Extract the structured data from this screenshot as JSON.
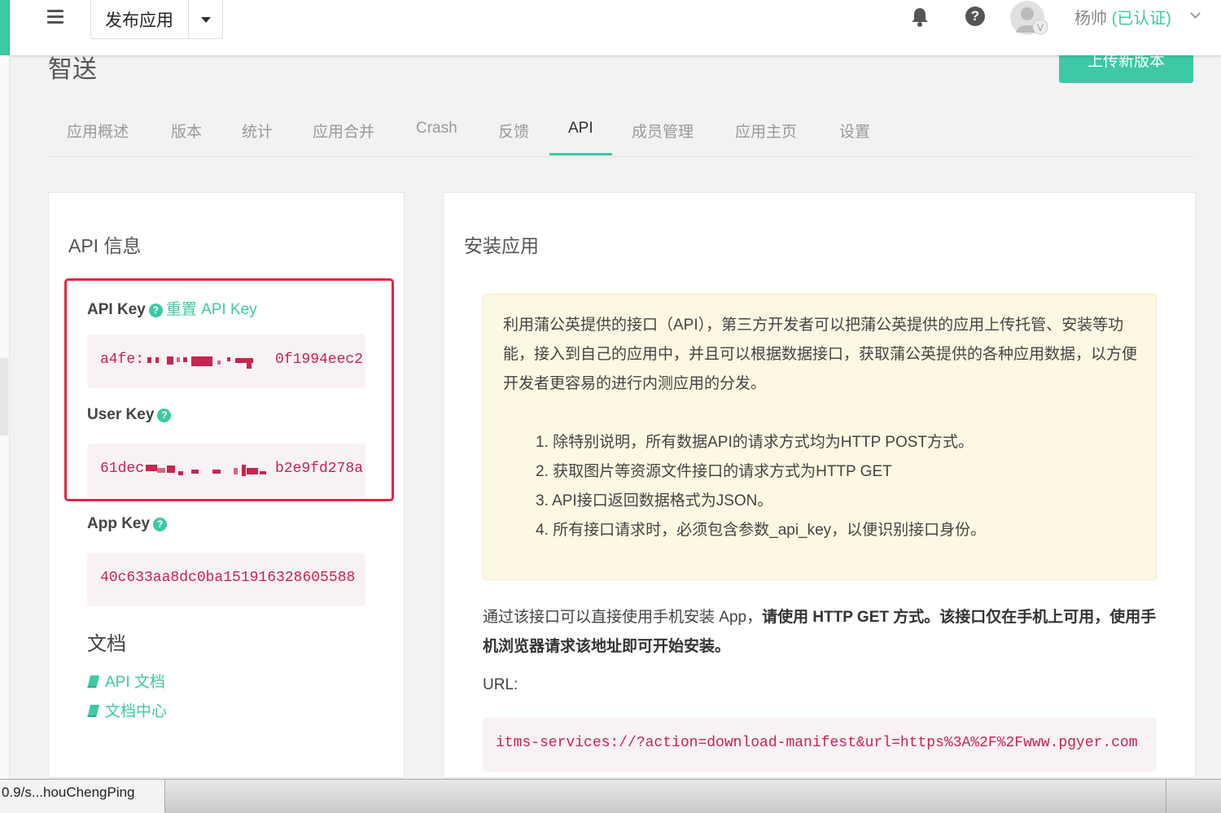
{
  "colors": {
    "accent": "#3dc9a4",
    "code": "#c7254e",
    "highlight_border": "#e8243f",
    "notice_bg": "#fcf8e3"
  },
  "header": {
    "app_selector": "发布应用",
    "user_name": "杨帅",
    "user_verified": "(已认证)",
    "icons": [
      "menu-icon",
      "bell-icon",
      "help-icon",
      "avatar"
    ]
  },
  "app": {
    "title": "智送",
    "upload_button": "上传新版本"
  },
  "tabs": [
    "应用概述",
    "版本",
    "统计",
    "应用合并",
    "Crash",
    "反馈",
    "API",
    "成员管理",
    "应用主页",
    "设置"
  ],
  "active_tab": "API",
  "api_info": {
    "title": "API 信息",
    "api_key_label": "API Key",
    "reset_link": "重置 API Key",
    "api_key_start": "a4fe:",
    "api_key_end": "0f1994eec2",
    "user_key_label": "User Key",
    "user_key_start": "61dec",
    "user_key_end": "b2e9fd278a",
    "app_key_label": "App Key",
    "app_key_value": "40c633aa8dc0ba151916328605588",
    "docs_title": "文档",
    "doc_links": [
      "API 文档",
      "文档中心"
    ]
  },
  "install": {
    "title": "安装应用",
    "notice_intro": "利用蒲公英提供的接口（API），第三方开发者可以把蒲公英提供的应用上传托管、安装等功能，接入到自己的应用中，并且可以根据数据接口，获取蒲公英提供的各种应用数据，以方便开发者更容易的进行内测应用的分发。",
    "notice_items": [
      "1. 除特别说明，所有数据API的请求方式均为HTTP POST方式。",
      "2. 获取图片等资源文件接口的请求方式为HTTP GET",
      "3. API接口返回数据格式为JSON。",
      "4. 所有接口请求时，必须包含参数_api_key，以便识别接口身份。"
    ],
    "desc_normal": "通过该接口可以直接使用手机安装 App，",
    "desc_bold": "请使用 HTTP GET 方式。该接口仅在手机上可用，使用手机浏览器请求该地址即可开始安装。",
    "url_label": "URL:",
    "url_value": "itms-services://?action=download-manifest&url=https%3A%2F%2Fwww.pgyer.com"
  },
  "statusbar": {
    "text": "0.9/s...houChengPing"
  }
}
